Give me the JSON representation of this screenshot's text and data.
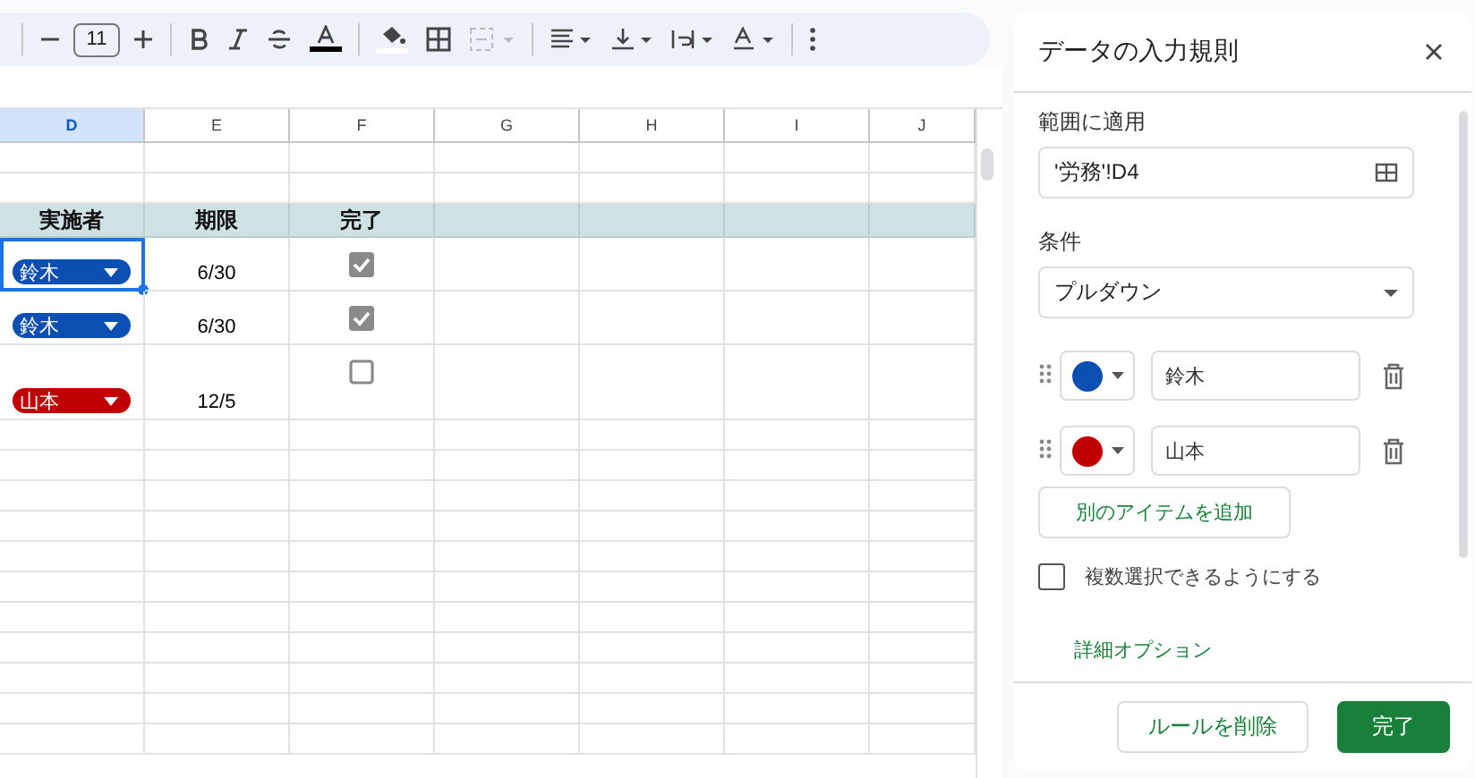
{
  "toolbar": {
    "font_size": "11"
  },
  "sheet": {
    "columns": [
      {
        "label": "D",
        "selected": true
      },
      {
        "label": "E",
        "selected": false
      },
      {
        "label": "F",
        "selected": false
      },
      {
        "label": "G",
        "selected": false
      },
      {
        "label": "H",
        "selected": false
      },
      {
        "label": "I",
        "selected": false
      },
      {
        "label": "J",
        "selected": false
      }
    ],
    "rows": [
      {
        "kind": "blank"
      },
      {
        "kind": "blank"
      },
      {
        "kind": "header",
        "cells": [
          "実施者",
          "期限",
          "完了"
        ]
      },
      {
        "kind": "task",
        "person": "鈴木",
        "color": "#0b4fb3",
        "deadline": "6/30",
        "done": true,
        "selected": true
      },
      {
        "kind": "task",
        "person": "鈴木",
        "color": "#0b4fb3",
        "deadline": "6/30",
        "done": true,
        "selected": false
      },
      {
        "kind": "task",
        "person": "山本",
        "color": "#c00000",
        "deadline": "12/5",
        "done": false,
        "selected": false,
        "tall": true
      }
    ]
  },
  "panel": {
    "title": "データの入力規則",
    "range_label": "範囲に適用",
    "range_value": "'労務'!D4",
    "criteria_label": "条件",
    "criteria_value": "プルダウン",
    "options": [
      {
        "value": "鈴木",
        "color": "#0b4fb3"
      },
      {
        "value": "山本",
        "color": "#c00000"
      }
    ],
    "add_button": "別のアイテムを追加",
    "multi_select": {
      "label": "複数選択できるようにする",
      "checked": false
    },
    "advanced_link": "詳細オプション",
    "buttons": [
      {
        "label": "ルールを削除",
        "kind": "secondary"
      },
      {
        "label": "完了",
        "kind": "primary"
      }
    ]
  }
}
